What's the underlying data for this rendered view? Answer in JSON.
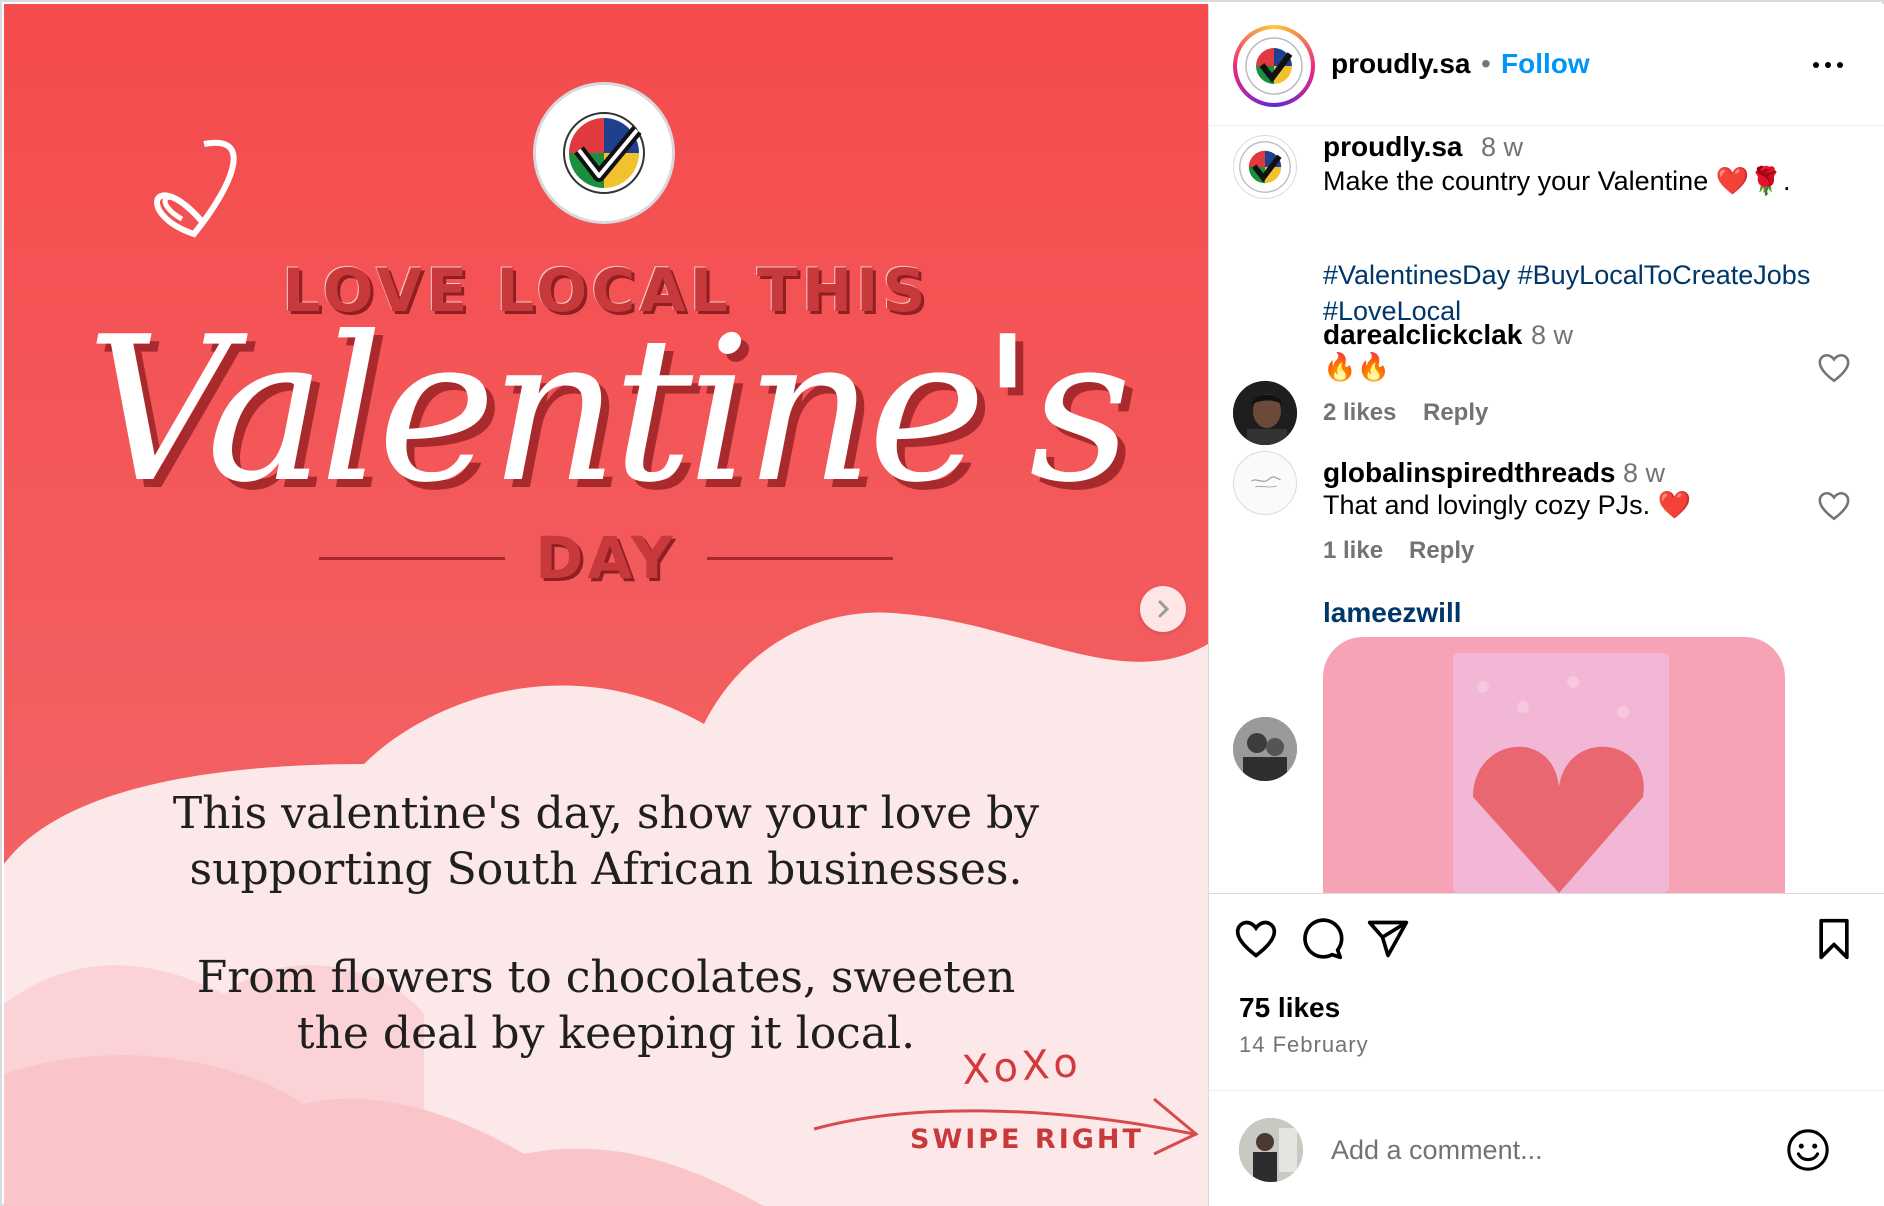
{
  "media": {
    "brand_badge_text": "PROUDLY SOUTH AFRICAN",
    "headline_top": "LOVE LOCAL THIS",
    "headline_script": "Valentine's",
    "headline_day": "DAY",
    "body_line_1": "This valentine's day, show your love by",
    "body_line_2": "supporting South African businesses.",
    "body_line_3": "From flowers to chocolates, sweeten",
    "body_line_4": "the deal by keeping it local.",
    "xoxo": "XoXo",
    "swipe": "SWIPE RIGHT",
    "colors": {
      "bg_red": "#f2585a",
      "cloud": "#fde8e9",
      "accent_dark": "#a92a2d"
    }
  },
  "header": {
    "username": "proudly.sa",
    "separator": "•",
    "follow_label": "Follow"
  },
  "caption": {
    "username": "proudly.sa",
    "time": "8 w",
    "text": "Make the country your Valentine ❤️🌹.",
    "hashtags": [
      "#ValentinesDay",
      "#BuyLocalToCreateJobs",
      "#LoveLocal"
    ]
  },
  "comments": [
    {
      "username": "darealclickclak",
      "time": "8 w",
      "text": "🔥🔥",
      "likes": "2 likes",
      "reply": "Reply"
    },
    {
      "username": "globalinspiredthreads",
      "time": "8 w",
      "text": "That and lovingly cozy PJs. ❤️",
      "likes": "1 like",
      "reply": "Reply"
    },
    {
      "username": "lameezwill"
    }
  ],
  "actions": {
    "icons": [
      "heart-icon",
      "comment-icon",
      "share-icon",
      "bookmark-icon"
    ],
    "likes": "75 likes",
    "date": "14 February"
  },
  "add_comment": {
    "placeholder": "Add a comment..."
  },
  "theme": {
    "link_blue": "#0095f6",
    "hashtag_blue": "#00376b",
    "muted": "#737373"
  }
}
